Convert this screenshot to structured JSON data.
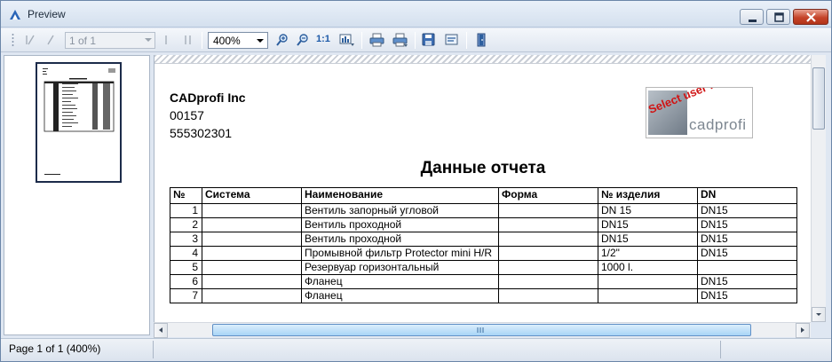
{
  "window": {
    "title": "Preview"
  },
  "toolbar": {
    "page_field": "1 of 1",
    "zoom": "400%",
    "zoom_actual_label": "1:1"
  },
  "report": {
    "company": "CADprofi Inc",
    "line2": "00157",
    "line3": "555302301",
    "logo_word": "cadprofi",
    "logo_overlay": "Select user logo",
    "title": "Данные отчета",
    "columns": [
      "№",
      "Система",
      "Наименование",
      "Форма",
      "№ изделия",
      "DN"
    ],
    "rows": [
      [
        "1",
        "",
        "Вентиль запорный угловой",
        "",
        "DN 15",
        "DN15"
      ],
      [
        "2",
        "",
        "Вентиль проходной",
        "",
        "DN15",
        "DN15"
      ],
      [
        "3",
        "",
        "Вентиль проходной",
        "",
        "DN15",
        "DN15"
      ],
      [
        "4",
        "",
        "Промывной фильтр Protector mini H/R",
        "",
        "1/2\"",
        "DN15"
      ],
      [
        "5",
        "",
        "Резервуар горизонтальный",
        "",
        "1000 l.",
        ""
      ],
      [
        "6",
        "",
        "Фланец",
        "",
        "",
        "DN15"
      ],
      [
        "7",
        "",
        "Фланец",
        "",
        "",
        "DN15"
      ]
    ]
  },
  "status": {
    "text": "Page 1 of 1 (400%)"
  },
  "colors": {
    "accent": "#1d5aa8",
    "close": "#c5442a",
    "logo_red": "#d01515"
  }
}
